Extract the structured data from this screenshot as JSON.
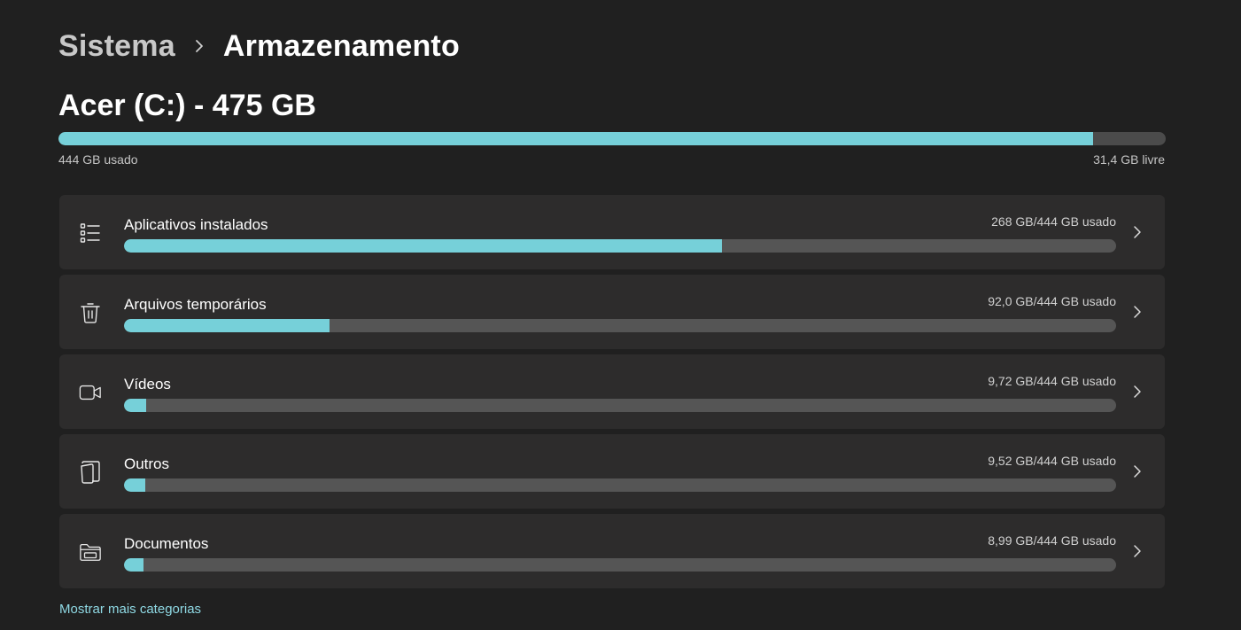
{
  "breadcrumb": {
    "parent": "Sistema",
    "current": "Armazenamento"
  },
  "drive": {
    "title": "Acer (C:) - 475 GB",
    "used_label": "444 GB usado",
    "free_label": "31,4 GB livre",
    "used_fraction": 0.934
  },
  "categories": [
    {
      "name": "Aplicativos instalados",
      "usage": "268 GB/444 GB usado",
      "fraction": 0.603,
      "icon": "list-icon"
    },
    {
      "name": "Arquivos temporários",
      "usage": "92,0 GB/444 GB usado",
      "fraction": 0.207,
      "icon": "trash-icon"
    },
    {
      "name": "Vídeos",
      "usage": "9,72 GB/444 GB usado",
      "fraction": 0.022,
      "icon": "video-camera-icon"
    },
    {
      "name": "Outros",
      "usage": "9,52 GB/444 GB usado",
      "fraction": 0.021,
      "icon": "other-files-icon"
    },
    {
      "name": "Documentos",
      "usage": "8,99 GB/444 GB usado",
      "fraction": 0.02,
      "icon": "documents-folder-icon"
    }
  ],
  "more_link": "Mostrar mais categorias",
  "colors": {
    "background": "#202020",
    "card": "#2d2c2c",
    "accent": "#76d0d9",
    "track": "#555555",
    "link": "#8fd9e4"
  }
}
